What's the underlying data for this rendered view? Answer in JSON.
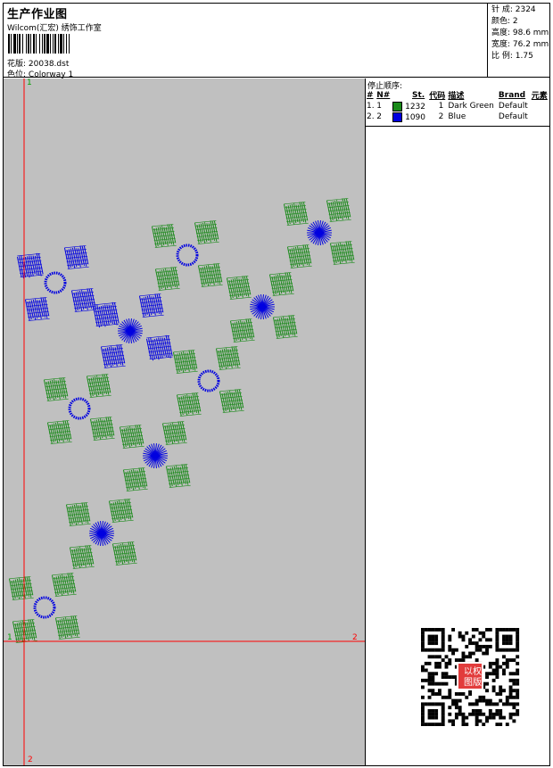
{
  "header": {
    "title": "生产作业图",
    "company": "Wilcom(汇宏) 绣饰工作室",
    "design_label": "花版:",
    "design_value": "20038.dst",
    "colorway_label": "色位:",
    "colorway_value": "Colorway 1"
  },
  "stats": {
    "stitches": "针 成: 2324",
    "colors": "颜色: 2",
    "height": "高度: 98.6 mm",
    "width": "宽度: 76.2 mm",
    "scale": "比 例: 1.75"
  },
  "stop_sequence": {
    "title": "停止顺序:",
    "columns": [
      "#",
      "N#",
      "St.",
      "代码",
      "描述",
      "Brand",
      "元素"
    ],
    "rows": [
      {
        "index": "1.",
        "n": "1",
        "color": "#1a8a1a",
        "stitches": "1232",
        "code": "1",
        "desc": "Dark Green",
        "brand": "Default"
      },
      {
        "index": "2.",
        "n": "2",
        "color": "#0000e0",
        "stitches": "1090",
        "code": "2",
        "desc": "Blue",
        "brand": "Default"
      }
    ]
  },
  "guides": {
    "top_left": "1",
    "left_mid": "1",
    "right_mid": "2",
    "bottom": "2"
  },
  "qr": {
    "stamp_text": [
      "以",
      "图",
      "版",
      "权"
    ]
  },
  "colors": {
    "green": "#1a8a1a",
    "blue": "#0000e0",
    "guide": "#ff0000",
    "canvas": "#c0c0c0"
  }
}
